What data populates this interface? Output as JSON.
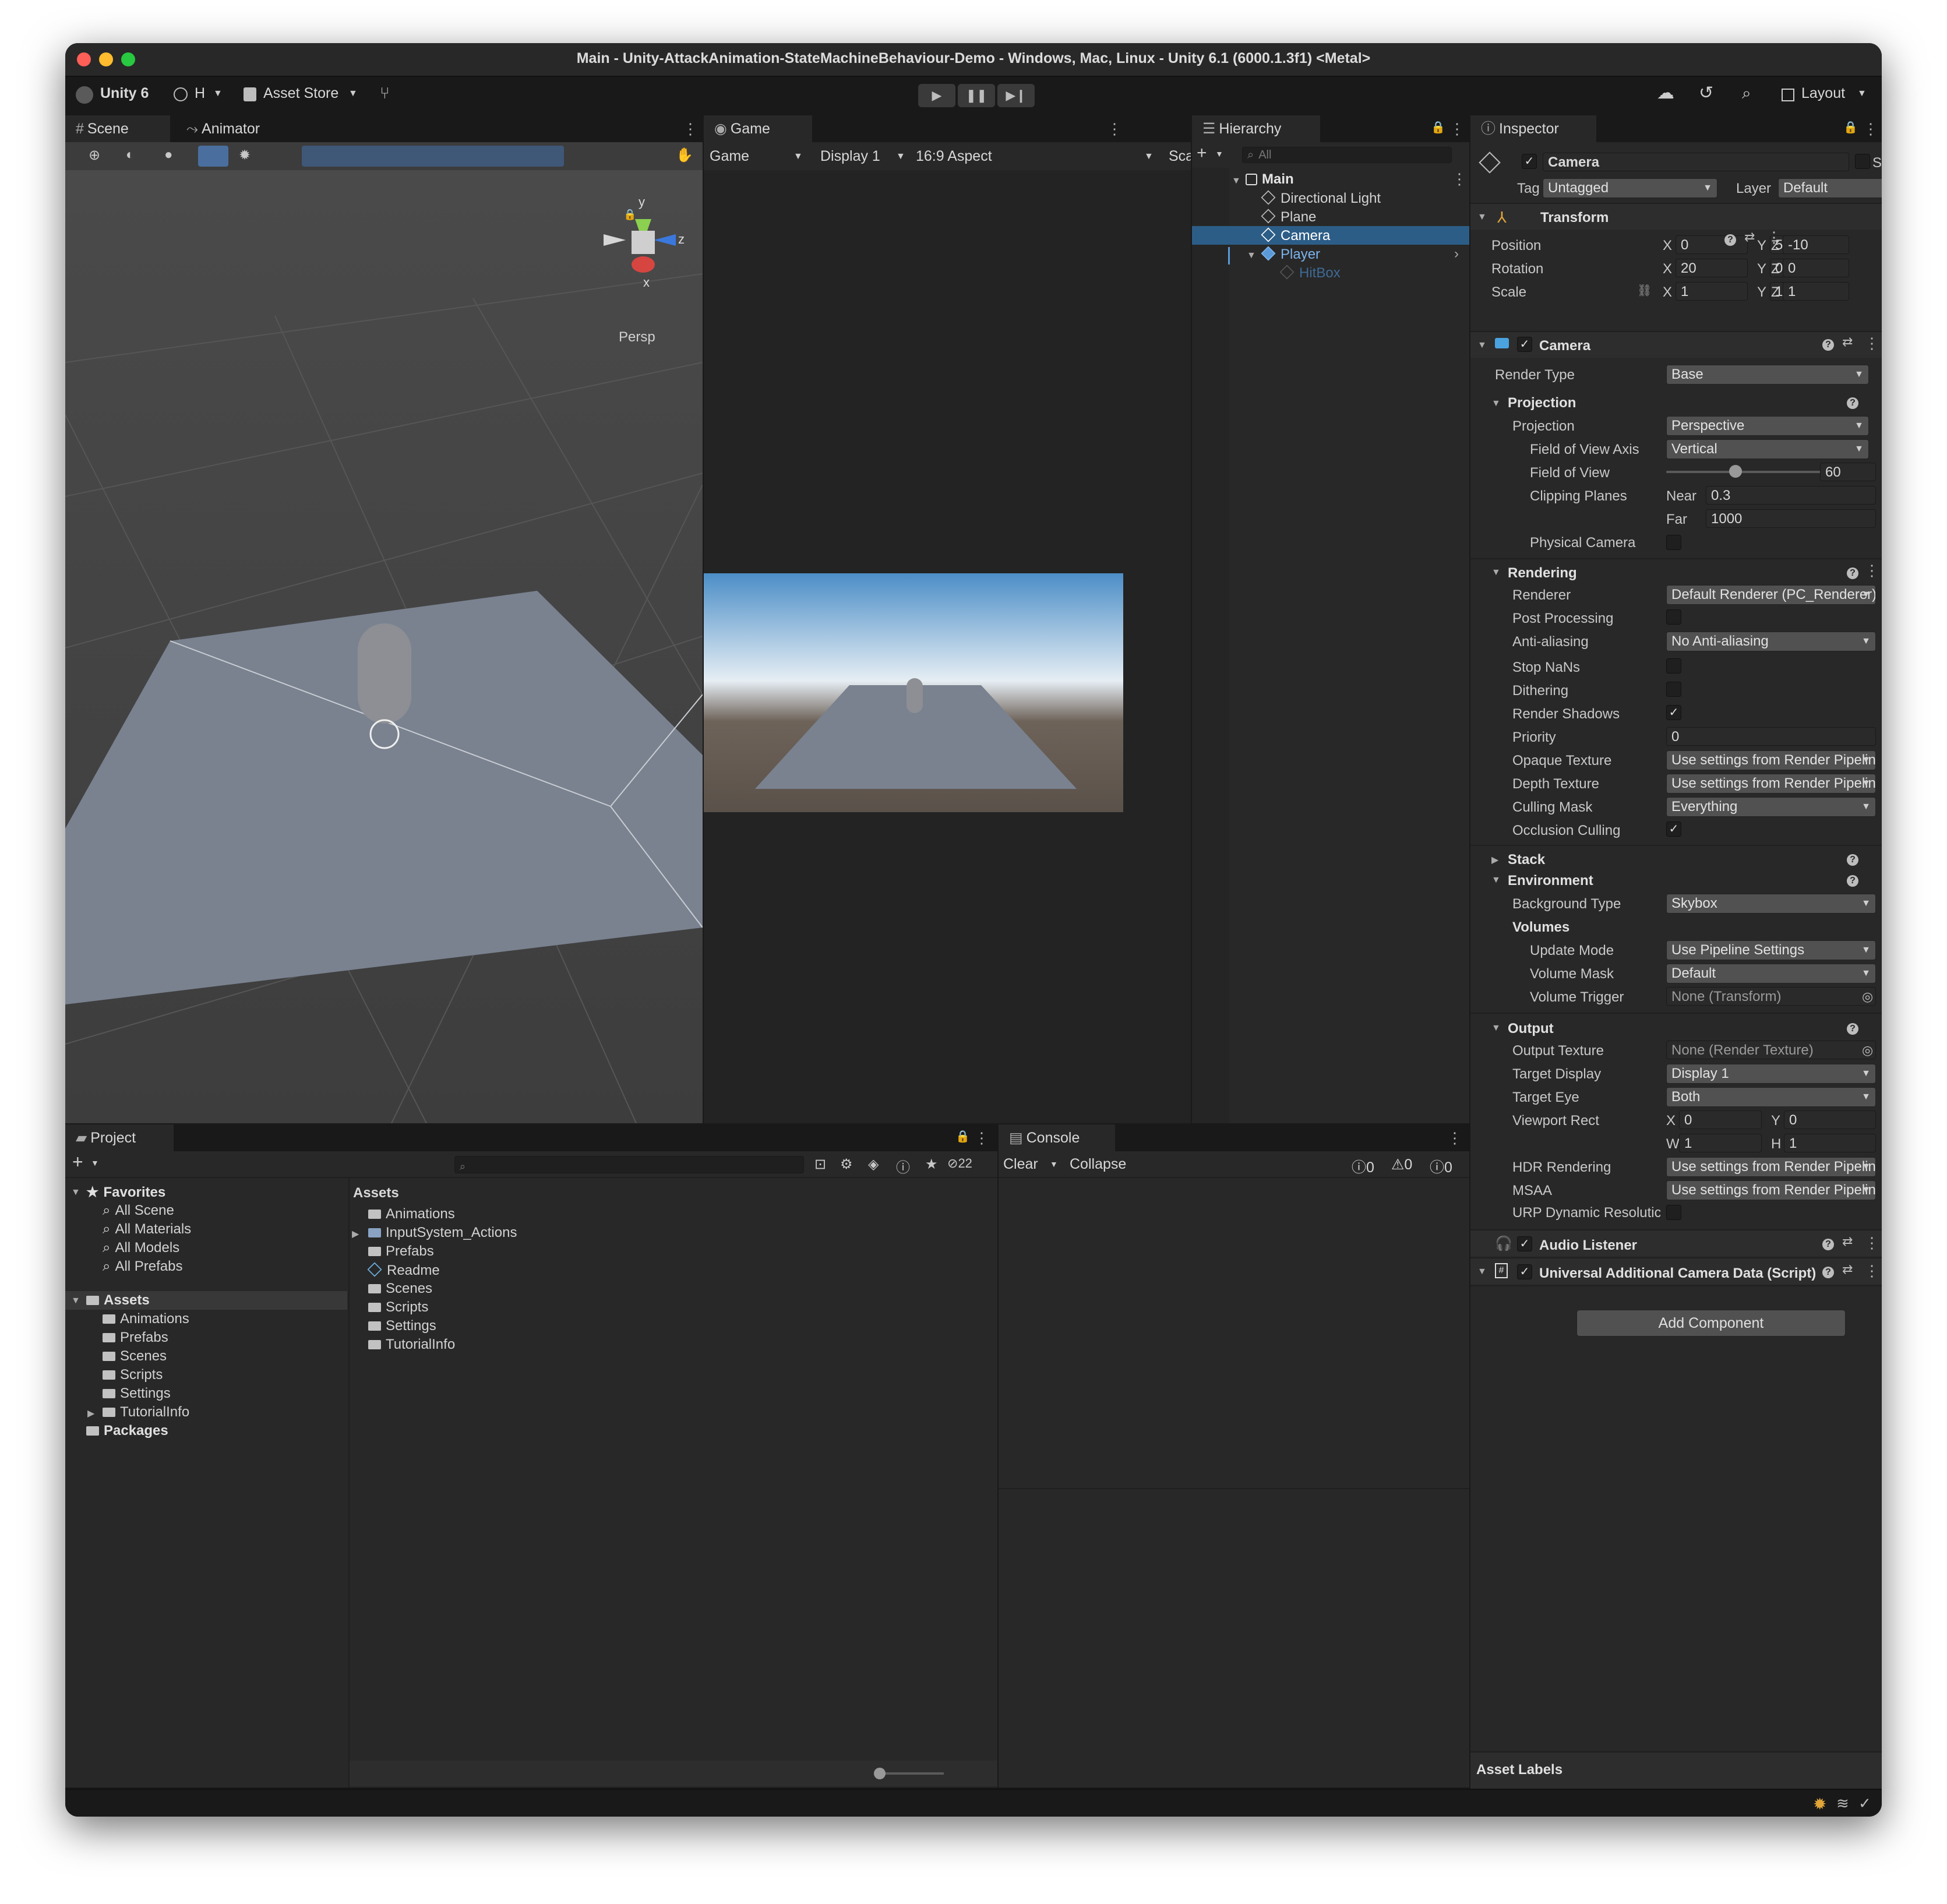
{
  "window": {
    "title": "Main - Unity-AttackAnimation-StateMachineBehaviour-Demo - Windows, Mac, Linux - Unity 6.1 (6000.1.3f1) <Metal>"
  },
  "toolbar": {
    "unity_label": "Unity 6",
    "account_label": "H",
    "asset_store_label": "Asset Store",
    "layout_label": "Layout"
  },
  "scene": {
    "tab_scene": "Scene",
    "tab_animator": "Animator",
    "gizmo_y": "y",
    "gizmo_z": "z",
    "gizmo_x": "x",
    "persp_label": "Persp"
  },
  "game": {
    "tab": "Game",
    "mode": "Game",
    "display": "Display 1",
    "aspect": "16:9 Aspect",
    "scale": "Sca"
  },
  "hierarchy": {
    "tab": "Hierarchy",
    "search_placeholder": "All",
    "scene_name": "Main",
    "items": [
      "Directional Light",
      "Plane",
      "Camera",
      "Player",
      "HitBox"
    ]
  },
  "inspector": {
    "tab": "Inspector",
    "object_name": "Camera",
    "static_label": "Static",
    "tag_label": "Tag",
    "tag_value": "Untagged",
    "layer_label": "Layer",
    "layer_value": "Default",
    "transform": {
      "title": "Transform",
      "position_label": "Position",
      "rotation_label": "Rotation",
      "scale_label": "Scale",
      "position": {
        "x": "0",
        "y": "5",
        "z": "-10"
      },
      "rotation": {
        "x": "20",
        "y": "0",
        "z": "0"
      },
      "scale": {
        "x": "1",
        "y": "1",
        "z": "1"
      }
    },
    "axis": {
      "x": "X",
      "y": "Y",
      "z": "Z",
      "w": "W",
      "h": "H"
    },
    "camera": {
      "title": "Camera",
      "render_type_label": "Render Type",
      "render_type": "Base",
      "projection_section": "Projection",
      "projection_label": "Projection",
      "projection_value": "Perspective",
      "fov_axis_label": "Field of View Axis",
      "fov_axis_value": "Vertical",
      "fov_label": "Field of View",
      "fov_value": "60",
      "fov_fraction": 0.33,
      "clipping_label": "Clipping Planes",
      "near_label": "Near",
      "near_value": "0.3",
      "far_label": "Far",
      "far_value": "1000",
      "physical_label": "Physical Camera",
      "rendering_section": "Rendering",
      "renderer_label": "Renderer",
      "renderer_value": "Default Renderer (PC_Renderer)",
      "post_label": "Post Processing",
      "aa_label": "Anti-aliasing",
      "aa_value": "No Anti-aliasing",
      "stopnans_label": "Stop NaNs",
      "dithering_label": "Dithering",
      "shadows_label": "Render Shadows",
      "priority_label": "Priority",
      "priority_value": "0",
      "opaque_label": "Opaque Texture",
      "opaque_value": "Use settings from Render Pipeline Ass",
      "depth_label": "Depth Texture",
      "depth_value": "Use settings from Render Pipeline Ass",
      "culling_label": "Culling Mask",
      "culling_value": "Everything",
      "occlusion_label": "Occlusion Culling",
      "stack_section": "Stack",
      "environment_section": "Environment",
      "bg_type_label": "Background Type",
      "bg_type_value": "Skybox",
      "volumes_label": "Volumes",
      "update_mode_label": "Update Mode",
      "update_mode_value": "Use Pipeline Settings",
      "volume_mask_label": "Volume Mask",
      "volume_mask_value": "Default",
      "volume_trigger_label": "Volume Trigger",
      "volume_trigger_value": "None (Transform)",
      "output_section": "Output",
      "output_texture_label": "Output Texture",
      "output_texture_value": "None (Render Texture)",
      "target_display_label": "Target Display",
      "target_display_value": "Display 1",
      "target_eye_label": "Target Eye",
      "target_eye_value": "Both",
      "viewport_label": "Viewport Rect",
      "viewport": {
        "x": "0",
        "y": "0",
        "w": "1",
        "h": "1"
      },
      "hdr_label": "HDR Rendering",
      "hdr_value": "Use settings from Render Pipeline Ass",
      "msaa_label": "MSAA",
      "msaa_value": "Use settings from Render Pipeline Ass",
      "urp_dynamic_label": "URP Dynamic Resolutic"
    },
    "audio_listener": "Audio Listener",
    "additional_data": "Universal Additional Camera Data (Script)",
    "add_component": "Add Component",
    "asset_labels": "Asset Labels"
  },
  "project": {
    "tab": "Project",
    "hidden_count": "22",
    "favorites_label": "Favorites",
    "favorites": [
      "All Scene",
      "All Materials",
      "All Models",
      "All Prefabs"
    ],
    "assets_label": "Assets",
    "asset_folders": [
      "Animations",
      "Prefabs",
      "Scenes",
      "Scripts",
      "Settings",
      "TutorialInfo"
    ],
    "packages_label": "Packages",
    "breadcrumb": "Assets",
    "grid_items": [
      "Animations",
      "InputSystem_Actions",
      "Prefabs",
      "Readme",
      "Scenes",
      "Scripts",
      "Settings",
      "TutorialInfo"
    ]
  },
  "console": {
    "tab": "Console",
    "clear": "Clear",
    "collapse": "Collapse",
    "info_count": "0",
    "warn_count": "0",
    "error_count": "0"
  }
}
